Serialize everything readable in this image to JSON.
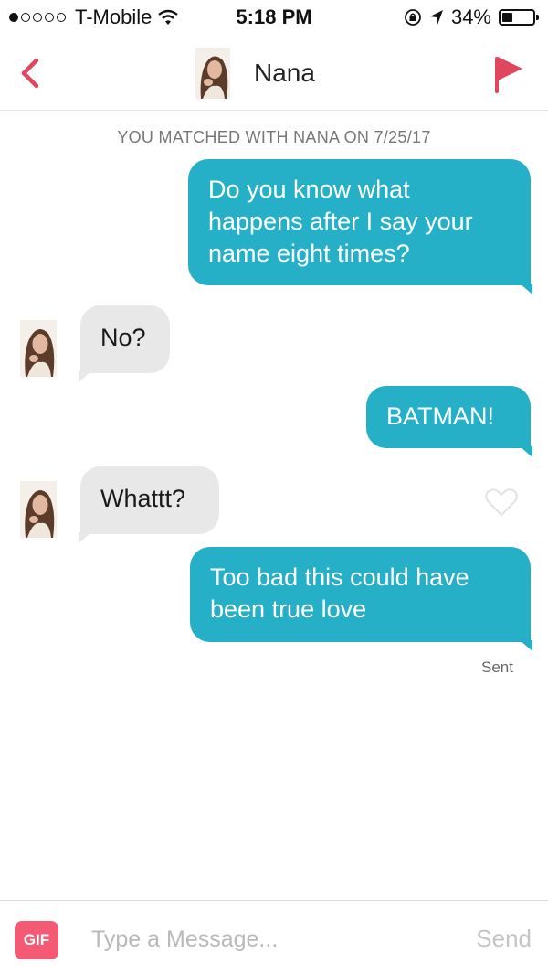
{
  "status_bar": {
    "carrier": "T-Mobile",
    "signal_dots_filled": 1,
    "signal_dots_total": 5,
    "time": "5:18 PM",
    "battery_percent": "34%",
    "battery_level": 0.34
  },
  "header": {
    "title": "Nana",
    "back_icon": "chevron-left-icon",
    "flag_icon": "flag-icon",
    "accent": "#e0465e"
  },
  "match_notice": "YOU MATCHED WITH NANA ON 7/25/17",
  "messages": [
    {
      "from": "me",
      "lines": [
        "Do you know what",
        "happens after I say your",
        "name eight times?"
      ]
    },
    {
      "from": "them",
      "text": "No?"
    },
    {
      "from": "me",
      "text": "BATMAN!"
    },
    {
      "from": "them",
      "text": "Whattt?"
    },
    {
      "from": "me",
      "lines": [
        "Too bad this could have",
        "been true love"
      ]
    }
  ],
  "sent_status": "Sent",
  "composer": {
    "gif_label": "GIF",
    "placeholder": "Type a Message...",
    "send_label": "Send"
  },
  "colors": {
    "sent_bubble": "#25b0c7",
    "received_bubble": "#e8e8e8",
    "gif_badge": "#f45a73"
  }
}
